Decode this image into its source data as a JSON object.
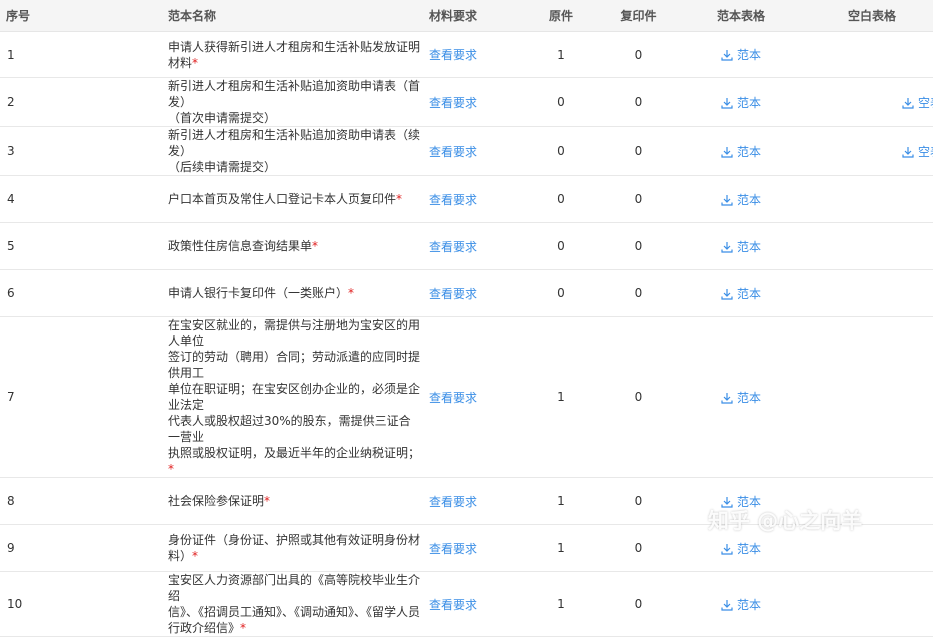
{
  "headers": {
    "no": "序号",
    "name": "范本名称",
    "req": "材料要求",
    "orig": "原件",
    "copy": "复印件",
    "sample": "范本表格",
    "blank": "空白表格"
  },
  "link_label": "查看要求",
  "accent_color": "#3a8ee6",
  "required_marker": "*",
  "rows": [
    {
      "no": "1",
      "lines": [
        "申请人获得新引进人才租房和生活补贴发放证明材料"
      ],
      "star": true,
      "orig": "1",
      "copy": "0",
      "sample": "范本",
      "blank": ""
    },
    {
      "no": "2",
      "lines": [
        "新引进人才租房和生活补贴追加资助申请表（首发）",
        "（首次申请需提交）"
      ],
      "star": false,
      "orig": "0",
      "copy": "0",
      "sample": "范本",
      "blank": "空表格"
    },
    {
      "no": "3",
      "lines": [
        "新引进人才租房和生活补贴追加资助申请表（续发）",
        "（后续申请需提交）"
      ],
      "star": false,
      "orig": "0",
      "copy": "0",
      "sample": "范本",
      "blank": "空表格"
    },
    {
      "no": "4",
      "lines": [
        "户口本首页及常住人口登记卡本人页复印件"
      ],
      "star": true,
      "orig": "0",
      "copy": "0",
      "sample": "范本",
      "blank": ""
    },
    {
      "no": "5",
      "lines": [
        "政策性住房信息查询结果单"
      ],
      "star": true,
      "orig": "0",
      "copy": "0",
      "sample": "范本",
      "blank": ""
    },
    {
      "no": "6",
      "lines": [
        "申请人银行卡复印件（一类账户）"
      ],
      "star": true,
      "orig": "0",
      "copy": "0",
      "sample": "范本",
      "blank": ""
    },
    {
      "no": "7",
      "lines": [
        "在宝安区就业的，需提供与注册地为宝安区的用人单位",
        "签订的劳动（聘用）合同；劳动派遣的应同时提供用工",
        "单位在职证明；在宝安区创办企业的，必须是企业法定",
        "代表人或股权超过30%的股东，需提供三证合一营业",
        "执照或股权证明，及最近半年的企业纳税证明；"
      ],
      "star": true,
      "orig": "1",
      "copy": "0",
      "sample": "范本",
      "blank": ""
    },
    {
      "no": "8",
      "lines": [
        "社会保险参保证明"
      ],
      "star": true,
      "orig": "1",
      "copy": "0",
      "sample": "范本",
      "blank": ""
    },
    {
      "no": "9",
      "lines": [
        "身份证件（身份证、护照或其他有效证明身份材料）"
      ],
      "star": true,
      "orig": "1",
      "copy": "0",
      "sample": "范本",
      "blank": ""
    },
    {
      "no": "10",
      "lines": [
        "宝安区人力资源部门出具的《高等院校毕业生介绍",
        "信》、《招调员工通知》、《调动通知》、《留学人员",
        "行政介绍信》"
      ],
      "star": true,
      "orig": "1",
      "copy": "0",
      "sample": "范本",
      "blank": ""
    }
  ],
  "watermark": "知乎 @心之向羊"
}
